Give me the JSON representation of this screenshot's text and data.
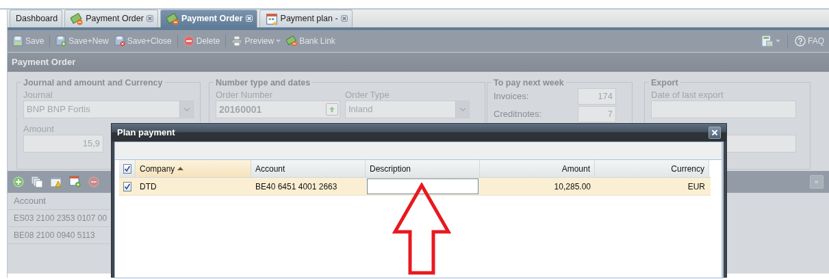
{
  "tabs": [
    {
      "label": "Dashboard",
      "kind": "plain",
      "closable": false,
      "selected": false
    },
    {
      "label": "Payment Order",
      "kind": "order",
      "closable": true,
      "selected": false
    },
    {
      "label": "Payment Order",
      "kind": "order",
      "closable": true,
      "selected": true
    },
    {
      "label": "Payment plan -",
      "kind": "plan",
      "closable": true,
      "selected": false
    }
  ],
  "toolbar": [
    {
      "label": "Save",
      "dropdown": false
    },
    {
      "label": "Save+New",
      "dropdown": false
    },
    {
      "label": "Save+Close",
      "dropdown": false
    },
    {
      "label": "Delete",
      "dropdown": false
    },
    {
      "label": "Preview",
      "dropdown": true
    },
    {
      "label": "Bank Link",
      "dropdown": false
    }
  ],
  "faq_label": "FAQ",
  "panel_title": "Payment Order",
  "journal_section": {
    "legend": "Journal and amount and Currency",
    "journal_label": "Journal",
    "journal_value": "BNP BNP Fortis",
    "amount_label": "Amount",
    "amount_value": "15,9"
  },
  "number_section": {
    "legend": "Number type and dates",
    "order_number_label": "Order Number",
    "order_number_value": "20160001",
    "order_type_label": "Order Type",
    "order_type_value": "Inland"
  },
  "pay_next_week": {
    "legend": "To pay next week",
    "rows": [
      {
        "label": "Invoices:",
        "value": "174"
      },
      {
        "label": "Creditnotes:",
        "value": "7"
      }
    ]
  },
  "export": {
    "legend": "Export",
    "date_label": "Date of last export"
  },
  "accounts_grid": {
    "column": "Account",
    "rows": [
      "ES03 2100 2353 0107 00",
      "BE08 2100 0940 5113"
    ]
  },
  "dialog": {
    "title": "Plan payment",
    "all_checked": true,
    "columns": [
      {
        "label": "Company",
        "sorted": true
      },
      {
        "label": "Account",
        "sorted": false
      },
      {
        "label": "Description",
        "sorted": false
      },
      {
        "label": "Amount",
        "sorted": false
      },
      {
        "label": "Currency",
        "sorted": false
      }
    ],
    "rows": [
      {
        "checked": true,
        "company": "DTD",
        "account": "BE40 6451 4001 2663",
        "amount": "10,285.00",
        "currency": "EUR"
      }
    ]
  }
}
